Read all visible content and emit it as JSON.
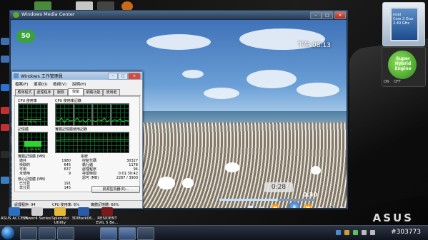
{
  "wmc": {
    "title": "Windows Media Center",
    "logo": "50",
    "clock": "下午 08:13",
    "time_bubble": "0:28",
    "elapsed": "0:30",
    "progress": 0.62,
    "buttons": [
      "■",
      "⏮",
      "⏪",
      "⏸",
      "⏩",
      "⏭",
      "🔊",
      "+",
      "-"
    ]
  },
  "taskmgr": {
    "title": "Windows 工作管理員",
    "menus": [
      "檔案(F)",
      "選項(O)",
      "檢視(V)",
      "說明(H)"
    ],
    "tabs": [
      "應用程式",
      "處理程序",
      "服務",
      "效能",
      "網路功能",
      "使用者"
    ],
    "active_tab": 3,
    "cpu_usage_label": "CPU 使用率",
    "cpu_history_label": "CPU 使用率記錄",
    "cpu_usage_value": "6 %",
    "memory_label": "記憶體",
    "memory_history_label": "實體記憶體使用記錄",
    "memory_value": "1.24 GB",
    "cpu_usage_pct": 6,
    "memory_pct": 64,
    "physical": {
      "heading": "實體記憶體 (MB)",
      "rows": [
        {
          "label": "總共",
          "value": "1980"
        },
        {
          "label": "快取的",
          "value": "645"
        },
        {
          "label": "可用",
          "value": "637"
        },
        {
          "label": "未使用",
          "value": "9"
        }
      ]
    },
    "kernel": {
      "heading": "核心記憶體 (MB)",
      "rows": [
        {
          "label": "已分頁",
          "value": "191"
        },
        {
          "label": "非分頁",
          "value": "145"
        }
      ]
    },
    "system": {
      "heading": "系統",
      "rows": [
        {
          "label": "控制代碼",
          "value": "30327"
        },
        {
          "label": "執行緒",
          "value": "1178"
        },
        {
          "label": "處理程序",
          "value": "94"
        },
        {
          "label": "存留時間",
          "value": "0:01:30:42"
        },
        {
          "label": "認可 (MB)",
          "value": "2287 / 3900"
        }
      ]
    },
    "resource_monitor_button": "資源監視器(R)...",
    "status": {
      "processes": "處理程序: 94",
      "cpu": "CPU 使用率: 6%",
      "memory": "實體記憶體: 66%"
    }
  },
  "gadgets": {
    "cpu_text": "intel\nCore 2 Duo\n2.40 GHz",
    "hybrid_text": "Super Hybrid Engine",
    "hybrid_switch": "ON    OFF"
  },
  "desktop_shortcuts": [
    {
      "label": "ASUS ACCESS",
      "color": "#2a6fc0"
    },
    {
      "label": "Power4 Series",
      "color": "#cfcfcf"
    },
    {
      "label": "Splendid Utility",
      "color": "#e5b93a"
    },
    {
      "label": "3DMark06...",
      "color": "#2b5aa8"
    },
    {
      "label": "RESIDENT EVIL 5 Be...",
      "color": "#7a1a1a"
    }
  ],
  "watermark": "#303773",
  "brand": "ASUS"
}
